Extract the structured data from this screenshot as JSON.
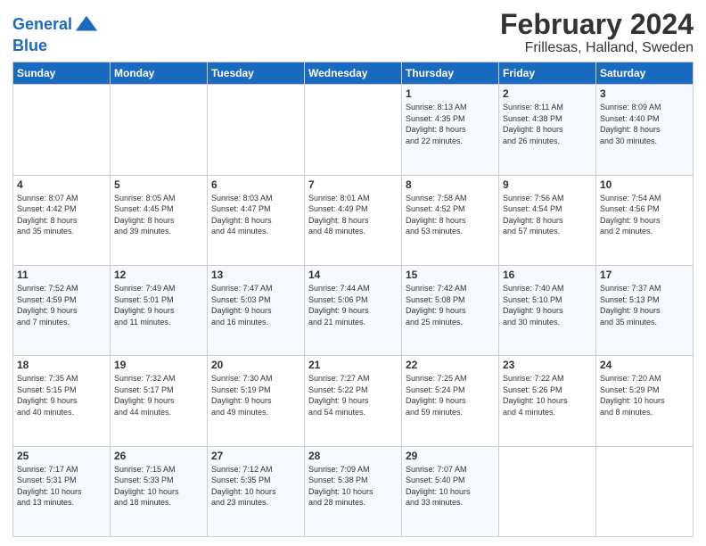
{
  "header": {
    "logo_line1": "General",
    "logo_line2": "Blue",
    "title": "February 2024",
    "subtitle": "Frillesas, Halland, Sweden"
  },
  "weekdays": [
    "Sunday",
    "Monday",
    "Tuesday",
    "Wednesday",
    "Thursday",
    "Friday",
    "Saturday"
  ],
  "weeks": [
    [
      {
        "day": "",
        "info": ""
      },
      {
        "day": "",
        "info": ""
      },
      {
        "day": "",
        "info": ""
      },
      {
        "day": "",
        "info": ""
      },
      {
        "day": "1",
        "info": "Sunrise: 8:13 AM\nSunset: 4:35 PM\nDaylight: 8 hours\nand 22 minutes."
      },
      {
        "day": "2",
        "info": "Sunrise: 8:11 AM\nSunset: 4:38 PM\nDaylight: 8 hours\nand 26 minutes."
      },
      {
        "day": "3",
        "info": "Sunrise: 8:09 AM\nSunset: 4:40 PM\nDaylight: 8 hours\nand 30 minutes."
      }
    ],
    [
      {
        "day": "4",
        "info": "Sunrise: 8:07 AM\nSunset: 4:42 PM\nDaylight: 8 hours\nand 35 minutes."
      },
      {
        "day": "5",
        "info": "Sunrise: 8:05 AM\nSunset: 4:45 PM\nDaylight: 8 hours\nand 39 minutes."
      },
      {
        "day": "6",
        "info": "Sunrise: 8:03 AM\nSunset: 4:47 PM\nDaylight: 8 hours\nand 44 minutes."
      },
      {
        "day": "7",
        "info": "Sunrise: 8:01 AM\nSunset: 4:49 PM\nDaylight: 8 hours\nand 48 minutes."
      },
      {
        "day": "8",
        "info": "Sunrise: 7:58 AM\nSunset: 4:52 PM\nDaylight: 8 hours\nand 53 minutes."
      },
      {
        "day": "9",
        "info": "Sunrise: 7:56 AM\nSunset: 4:54 PM\nDaylight: 8 hours\nand 57 minutes."
      },
      {
        "day": "10",
        "info": "Sunrise: 7:54 AM\nSunset: 4:56 PM\nDaylight: 9 hours\nand 2 minutes."
      }
    ],
    [
      {
        "day": "11",
        "info": "Sunrise: 7:52 AM\nSunset: 4:59 PM\nDaylight: 9 hours\nand 7 minutes."
      },
      {
        "day": "12",
        "info": "Sunrise: 7:49 AM\nSunset: 5:01 PM\nDaylight: 9 hours\nand 11 minutes."
      },
      {
        "day": "13",
        "info": "Sunrise: 7:47 AM\nSunset: 5:03 PM\nDaylight: 9 hours\nand 16 minutes."
      },
      {
        "day": "14",
        "info": "Sunrise: 7:44 AM\nSunset: 5:06 PM\nDaylight: 9 hours\nand 21 minutes."
      },
      {
        "day": "15",
        "info": "Sunrise: 7:42 AM\nSunset: 5:08 PM\nDaylight: 9 hours\nand 25 minutes."
      },
      {
        "day": "16",
        "info": "Sunrise: 7:40 AM\nSunset: 5:10 PM\nDaylight: 9 hours\nand 30 minutes."
      },
      {
        "day": "17",
        "info": "Sunrise: 7:37 AM\nSunset: 5:13 PM\nDaylight: 9 hours\nand 35 minutes."
      }
    ],
    [
      {
        "day": "18",
        "info": "Sunrise: 7:35 AM\nSunset: 5:15 PM\nDaylight: 9 hours\nand 40 minutes."
      },
      {
        "day": "19",
        "info": "Sunrise: 7:32 AM\nSunset: 5:17 PM\nDaylight: 9 hours\nand 44 minutes."
      },
      {
        "day": "20",
        "info": "Sunrise: 7:30 AM\nSunset: 5:19 PM\nDaylight: 9 hours\nand 49 minutes."
      },
      {
        "day": "21",
        "info": "Sunrise: 7:27 AM\nSunset: 5:22 PM\nDaylight: 9 hours\nand 54 minutes."
      },
      {
        "day": "22",
        "info": "Sunrise: 7:25 AM\nSunset: 5:24 PM\nDaylight: 9 hours\nand 59 minutes."
      },
      {
        "day": "23",
        "info": "Sunrise: 7:22 AM\nSunset: 5:26 PM\nDaylight: 10 hours\nand 4 minutes."
      },
      {
        "day": "24",
        "info": "Sunrise: 7:20 AM\nSunset: 5:29 PM\nDaylight: 10 hours\nand 8 minutes."
      }
    ],
    [
      {
        "day": "25",
        "info": "Sunrise: 7:17 AM\nSunset: 5:31 PM\nDaylight: 10 hours\nand 13 minutes."
      },
      {
        "day": "26",
        "info": "Sunrise: 7:15 AM\nSunset: 5:33 PM\nDaylight: 10 hours\nand 18 minutes."
      },
      {
        "day": "27",
        "info": "Sunrise: 7:12 AM\nSunset: 5:35 PM\nDaylight: 10 hours\nand 23 minutes."
      },
      {
        "day": "28",
        "info": "Sunrise: 7:09 AM\nSunset: 5:38 PM\nDaylight: 10 hours\nand 28 minutes."
      },
      {
        "day": "29",
        "info": "Sunrise: 7:07 AM\nSunset: 5:40 PM\nDaylight: 10 hours\nand 33 minutes."
      },
      {
        "day": "",
        "info": ""
      },
      {
        "day": "",
        "info": ""
      }
    ]
  ]
}
